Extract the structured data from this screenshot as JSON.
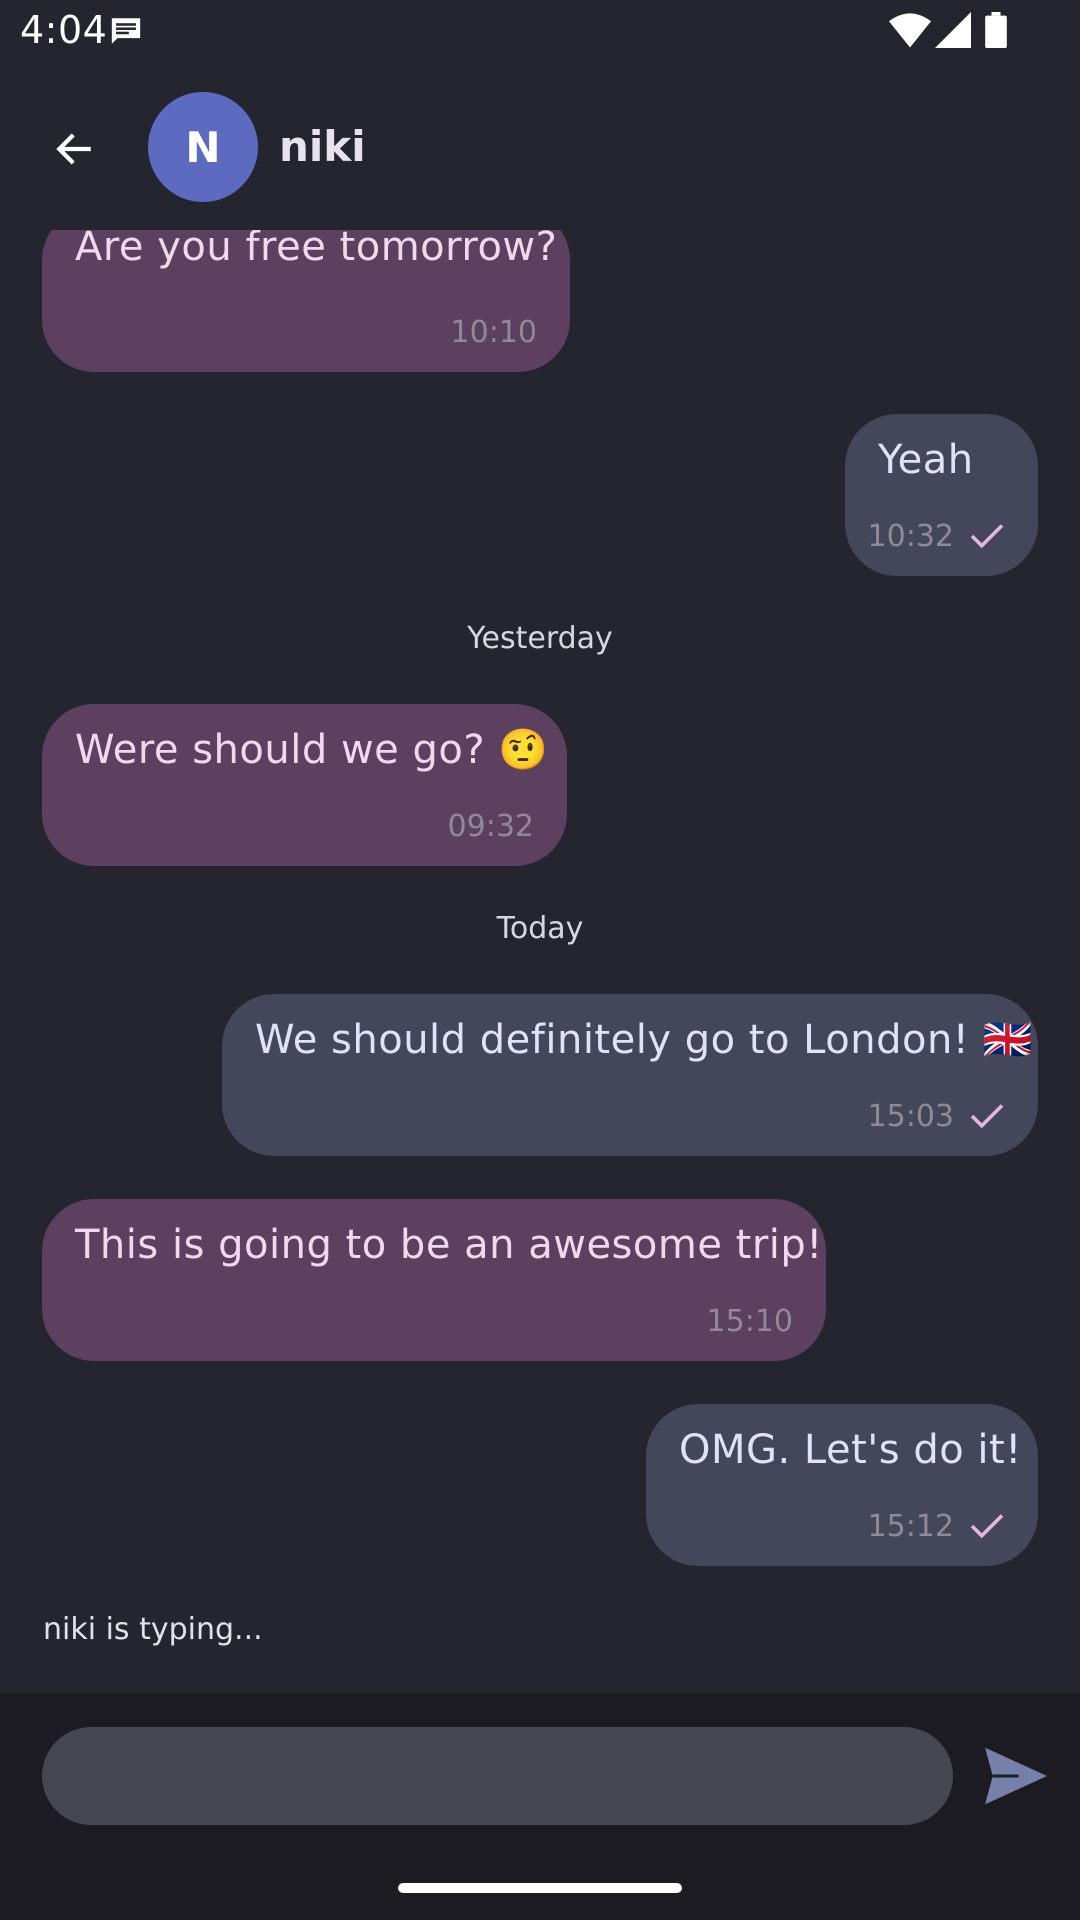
{
  "status_bar": {
    "time": "4:04"
  },
  "header": {
    "avatar_initial": "N",
    "contact_name": "niki"
  },
  "messages": [
    {
      "text": "Are you free tomorrow?",
      "time": "10:10"
    },
    {
      "text": "Yeah",
      "time": "10:32"
    },
    {
      "text": "Were should we go? 🤨",
      "time": "09:32"
    },
    {
      "text": "We should definitely go to London! 🇬🇧",
      "time": "15:03"
    },
    {
      "text": "This is going to be an awesome trip!",
      "time": "15:10"
    },
    {
      "text": "OMG. Let's do it!",
      "time": "15:12"
    }
  ],
  "date_separators": [
    "Yesterday",
    "Today"
  ],
  "typing_indicator": "niki is typing...",
  "composer": {
    "value": "",
    "placeholder": ""
  },
  "colors": {
    "background": "#24252f",
    "incoming_bubble": "#5d3f60",
    "outgoing_bubble": "#434759",
    "avatar": "#5c6bc0",
    "check": "#e5b5e3",
    "send": "#7680aa"
  }
}
